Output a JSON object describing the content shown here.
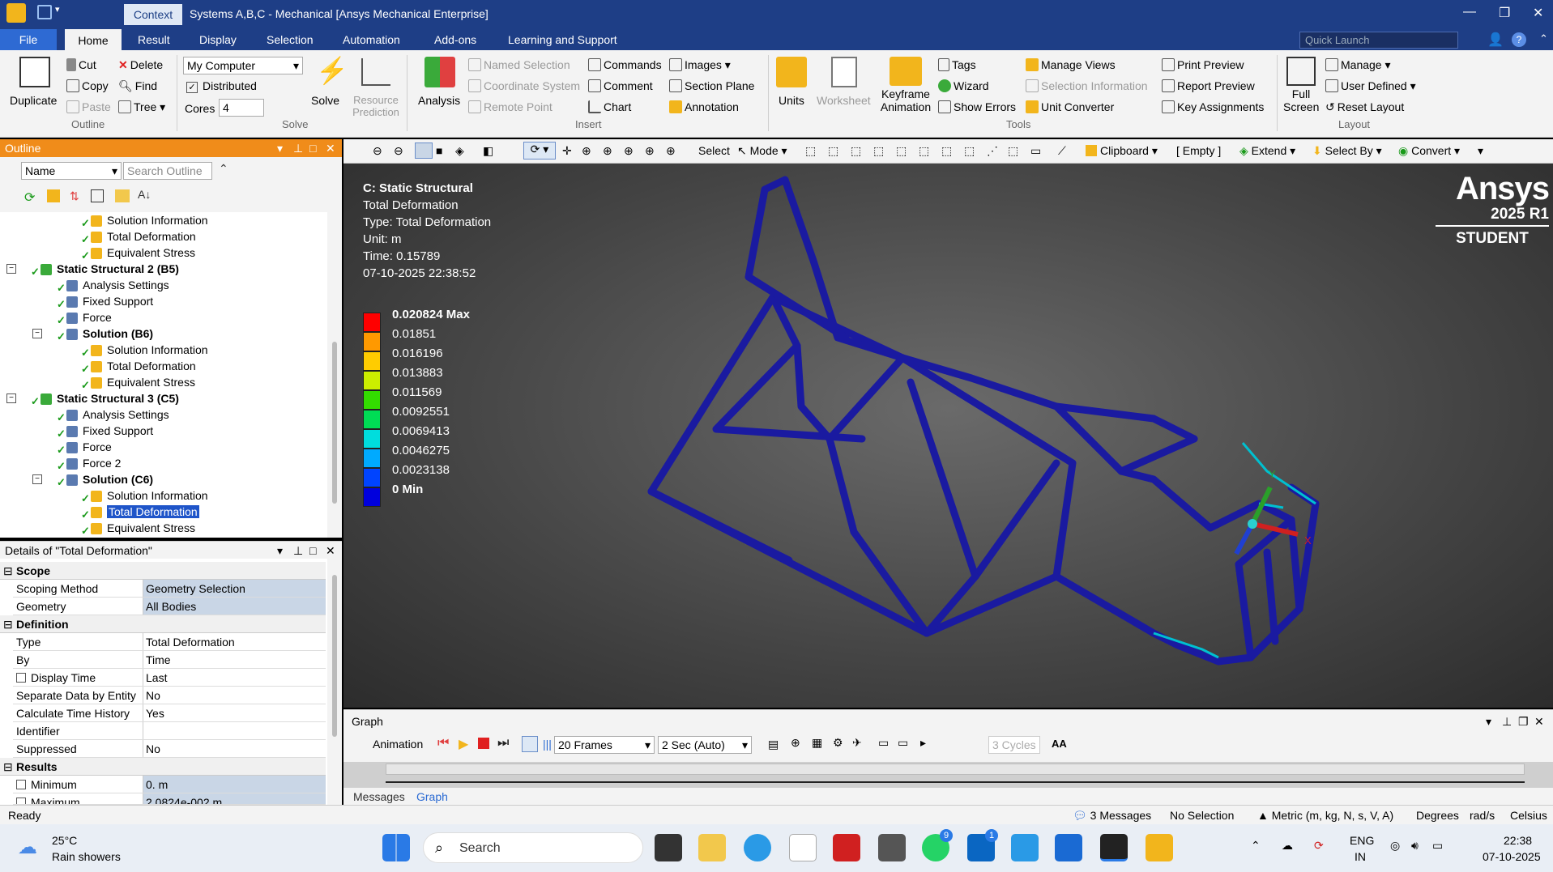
{
  "titlebar": {
    "context": "Context",
    "title": "Systems A,B,C - Mechanical [Ansys Mechanical Enterprise]"
  },
  "menu": {
    "file": "File",
    "home": "Home",
    "result": "Result",
    "display": "Display",
    "selection": "Selection",
    "automation": "Automation",
    "addons": "Add-ons",
    "learning": "Learning and Support",
    "quick_launch_placeholder": "Quick Launch"
  },
  "ribbon": {
    "duplicate": "Duplicate",
    "cut": "Cut",
    "copy": "Copy",
    "paste": "Paste",
    "delete": "Delete",
    "find": "Find",
    "tree": "Tree",
    "group_outline": "Outline",
    "computer": "My Computer",
    "distributed": "Distributed",
    "cores_label": "Cores",
    "cores_value": "4",
    "solve": "Solve",
    "resource_prediction": "Resource Prediction",
    "group_solve": "Solve",
    "analysis": "Analysis",
    "named_selection": "Named Selection",
    "coordinate_system": "Coordinate System",
    "remote_point": "Remote Point",
    "commands": "Commands",
    "comment": "Comment",
    "chart": "Chart",
    "images": "Images",
    "section_plane": "Section Plane",
    "annotation": "Annotation",
    "group_insert": "Insert",
    "units": "Units",
    "worksheet": "Worksheet",
    "keyframe_animation": "Keyframe Animation",
    "tags": "Tags",
    "wizard": "Wizard",
    "show_errors": "Show Errors",
    "manage_views": "Manage Views",
    "selection_information": "Selection Information",
    "unit_converter": "Unit Converter",
    "print_preview": "Print Preview",
    "report_preview": "Report Preview",
    "key_assignments": "Key Assignments",
    "group_tools": "Tools",
    "full_screen": "Full Screen",
    "manage": "Manage",
    "user_defined": "User Defined",
    "reset_layout": "Reset Layout",
    "group_layout": "Layout"
  },
  "outline": {
    "title": "Outline",
    "name_col": "Name",
    "search_placeholder": "Search Outline",
    "items": [
      {
        "label": "Solution Information",
        "level": 4
      },
      {
        "label": "Total Deformation",
        "level": 4
      },
      {
        "label": "Equivalent Stress",
        "level": 4
      },
      {
        "label": "Static Structural 2 (B5)",
        "level": 2,
        "bold": true
      },
      {
        "label": "Analysis Settings",
        "level": 3
      },
      {
        "label": "Fixed Support",
        "level": 3
      },
      {
        "label": "Force",
        "level": 3
      },
      {
        "label": "Solution (B6)",
        "level": 3,
        "bold": true
      },
      {
        "label": "Solution Information",
        "level": 4
      },
      {
        "label": "Total Deformation",
        "level": 4
      },
      {
        "label": "Equivalent Stress",
        "level": 4
      },
      {
        "label": "Static Structural 3 (C5)",
        "level": 2,
        "bold": true
      },
      {
        "label": "Analysis Settings",
        "level": 3
      },
      {
        "label": "Fixed Support",
        "level": 3
      },
      {
        "label": "Force",
        "level": 3
      },
      {
        "label": "Force 2",
        "level": 3
      },
      {
        "label": "Solution (C6)",
        "level": 3,
        "bold": true
      },
      {
        "label": "Solution Information",
        "level": 4
      },
      {
        "label": "Total Deformation",
        "level": 4,
        "selected": true
      },
      {
        "label": "Equivalent Stress",
        "level": 4
      }
    ]
  },
  "details": {
    "title": "Details of \"Total Deformation\"",
    "scope": "Scope",
    "scoping_method_k": "Scoping Method",
    "scoping_method_v": "Geometry Selection",
    "geometry_k": "Geometry",
    "geometry_v": "All Bodies",
    "definition": "Definition",
    "type_k": "Type",
    "type_v": "Total Deformation",
    "by_k": "By",
    "by_v": "Time",
    "display_time_k": "Display Time",
    "display_time_v": "Last",
    "separate_k": "Separate Data by Entity",
    "separate_v": "No",
    "calc_k": "Calculate Time History",
    "calc_v": "Yes",
    "identifier_k": "Identifier",
    "identifier_v": "",
    "suppressed_k": "Suppressed",
    "suppressed_v": "No",
    "results": "Results",
    "minimum_k": "Minimum",
    "minimum_v": "0. m",
    "maximum_k": "Maximum",
    "maximum_v": "2.0824e-002 m"
  },
  "viewtb": {
    "select": "Select",
    "mode": "Mode",
    "clipboard": "Clipboard",
    "empty": "[ Empty ]",
    "extend": "Extend",
    "select_by": "Select By",
    "convert": "Convert"
  },
  "viewport": {
    "result_title": "C: Static Structural",
    "result_name": "Total Deformation",
    "result_type": "Type: Total Deformation",
    "unit": "Unit: m",
    "time": "Time: 0.15789",
    "timestamp": "07-10-2025 22:38:52",
    "legend": [
      "0.020824 Max",
      "0.01851",
      "0.016196",
      "0.013883",
      "0.011569",
      "0.0092551",
      "0.0069413",
      "0.0046275",
      "0.0023138",
      "0 Min"
    ],
    "legend_colors": [
      "#ff0000",
      "#ff9900",
      "#ffcc00",
      "#ccee00",
      "#33dd00",
      "#00dd55",
      "#00dddd",
      "#00aaff",
      "#0044ff",
      "#0000dd"
    ],
    "logo": "Ansys",
    "version": "2025 R1",
    "edition": "STUDENT",
    "axis_x": "X",
    "axis_y": "Y"
  },
  "graph": {
    "title": "Graph",
    "animation": "Animation",
    "frames": "20 Frames",
    "duration": "2 Sec (Auto)",
    "cycles": "3 Cycles",
    "aa": "AA",
    "tab_messages": "Messages",
    "tab_graph": "Graph"
  },
  "status": {
    "ready": "Ready",
    "messages": "3 Messages",
    "selection": "No Selection",
    "units": "Metric (m, kg, N, s, V, A)",
    "degrees": "Degrees",
    "rads": "rad/s",
    "celsius": "Celsius"
  },
  "taskbar": {
    "temp": "25°C",
    "weather": "Rain showers",
    "search": "Search",
    "lang1": "ENG",
    "lang2": "IN",
    "time": "22:38",
    "date": "07-10-2025",
    "whatsapp_badge": "9",
    "linkedin_badge": "1"
  }
}
